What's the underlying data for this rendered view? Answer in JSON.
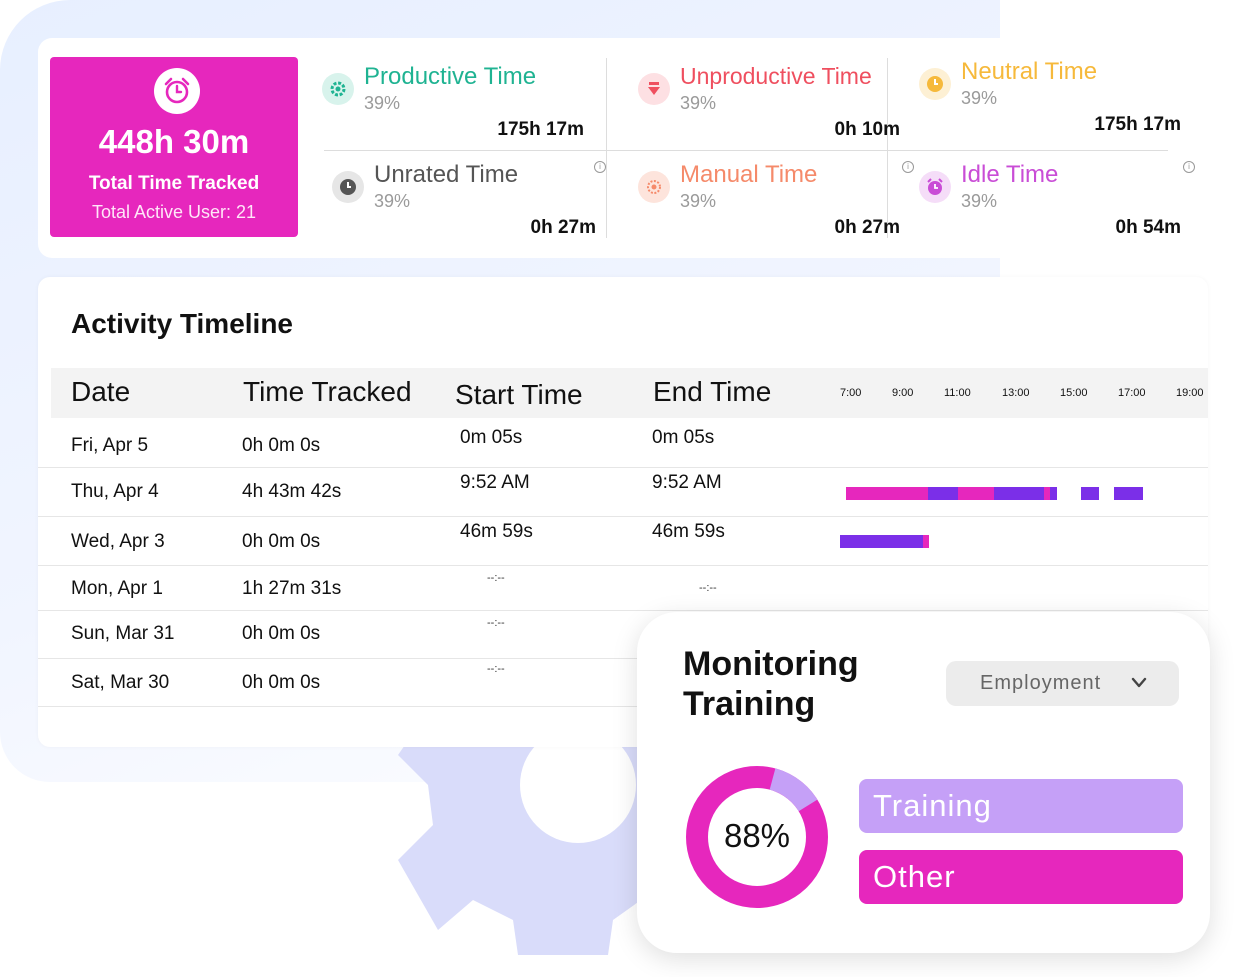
{
  "summary": {
    "total_value": "448h 30m",
    "total_label": "Total Time Tracked",
    "active_users": "Total Active User: 21",
    "stats": [
      {
        "name": "Productive Time",
        "pct": "39%",
        "value": "175h 17m",
        "color": "#1fb392",
        "icon": "gear-icon"
      },
      {
        "name": "Unproductive Time",
        "pct": "39%",
        "value": "0h 10m",
        "color": "#ef4f5f",
        "icon": "arrow-down-icon"
      },
      {
        "name": "Neutral Time",
        "pct": "39%",
        "value": "175h 17m",
        "color": "#f6b93b",
        "icon": "clock-icon"
      },
      {
        "name": "Unrated Time",
        "pct": "39%",
        "value": "0h 27m",
        "color": "#555555",
        "icon": "clock-icon",
        "info": "i"
      },
      {
        "name": "Manual Time",
        "pct": "39%",
        "value": "0h 27m",
        "color": "#f58a6a",
        "icon": "hand-icon",
        "info": "i"
      },
      {
        "name": "Idle Time",
        "pct": "39%",
        "value": "0h 54m",
        "color": "#c94dd6",
        "icon": "alarm-icon",
        "info": "i"
      }
    ]
  },
  "timeline": {
    "title": "Activity Timeline",
    "headers": [
      "Date",
      "Time Tracked",
      "Start Time",
      "End Time"
    ],
    "hours": [
      "7:00",
      "9:00",
      "11:00",
      "13:00",
      "15:00",
      "17:00",
      "19:00"
    ],
    "rows": [
      {
        "date": "Fri, Apr 5",
        "tracked": "0h 0m 0s",
        "start": "0m 05s",
        "end": "0m 05s"
      },
      {
        "date": "Thu, Apr 4",
        "tracked": "4h 43m 42s",
        "start": "9:52 AM",
        "end": "9:52 AM"
      },
      {
        "date": "Wed, Apr 3",
        "tracked": "0h 0m 0s",
        "start": "46m 59s",
        "end": "46m 59s"
      },
      {
        "date": "Mon, Apr 1",
        "tracked": "1h 27m 31s",
        "start": "--:--",
        "end": "--:--"
      },
      {
        "date": "Sun, Mar 31",
        "tracked": "0h 0m 0s",
        "start": "--:--",
        "end": ""
      },
      {
        "date": "Sat, Mar 30",
        "tracked": "0h 0m 0s",
        "start": "--:--",
        "end": ""
      }
    ]
  },
  "monitoring": {
    "title_line1": "Monitoring",
    "title_line2": "Training",
    "dropdown_value": "Employment",
    "percent": 88,
    "percent_label": "88%",
    "legend": [
      {
        "label": "Training",
        "color": "#c5a0f7"
      },
      {
        "label": "Other",
        "color": "#e627bd"
      }
    ]
  },
  "colors": {
    "accent": "#e627bd",
    "purple": "#7b2fe8",
    "light_purple": "#c5a0f7"
  }
}
